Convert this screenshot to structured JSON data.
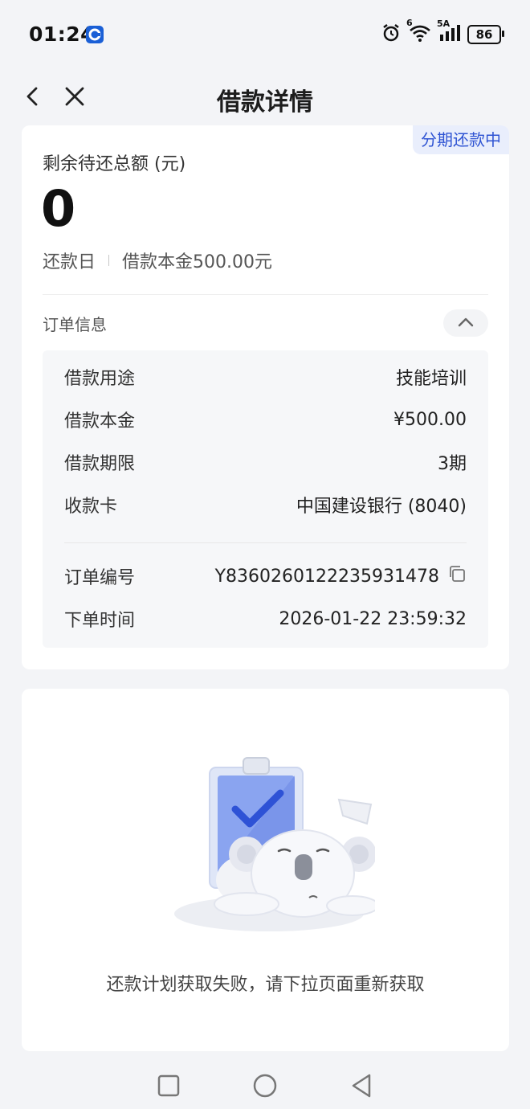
{
  "status_bar": {
    "time": "01:24",
    "battery": "86",
    "signal_label_1": "6",
    "signal_label_2": "5A",
    "icons": [
      "app-badge-icon",
      "alarm-icon",
      "wifi-icon",
      "cellular-signal-icon",
      "battery-icon"
    ]
  },
  "nav": {
    "title": "借款详情",
    "back_icon": "chevron-left-icon",
    "close_icon": "close-icon"
  },
  "loan": {
    "status_tag": "分期还款中",
    "remaining_label": "剩余待还总额 (元)",
    "remaining_amount": "0",
    "repayment_day_label": "还款日",
    "principal_summary": "借款本金500.00元"
  },
  "order": {
    "section_label": "订单信息",
    "collapse_icon": "chevron-up-icon",
    "rows": [
      {
        "label": "借款用途",
        "value": "技能培训"
      },
      {
        "label": "借款本金",
        "value": "¥500.00"
      },
      {
        "label": "借款期限",
        "value": "3期"
      },
      {
        "label": "收款卡",
        "value": "中国建设银行 (8040)"
      }
    ],
    "order_no_label": "订单编号",
    "order_no_value": "Y8360260122235931478",
    "copy_icon": "copy-icon",
    "order_time_label": "下单时间",
    "order_time_value": "2026-01-22 23:59:32"
  },
  "plan": {
    "illustration": "sleeping-koala-clipboard-illustration",
    "error_message": "还款计划获取失败，请下拉页面重新获取"
  },
  "system_nav": {
    "icons": [
      "recents-square-icon",
      "home-circle-icon",
      "back-triangle-icon"
    ]
  },
  "colors": {
    "accent": "#2f54d3",
    "tag_bg": "#e9eefc",
    "page_bg": "#f3f4f7",
    "card_bg": "#ffffff",
    "info_bg": "#f6f7f9"
  }
}
